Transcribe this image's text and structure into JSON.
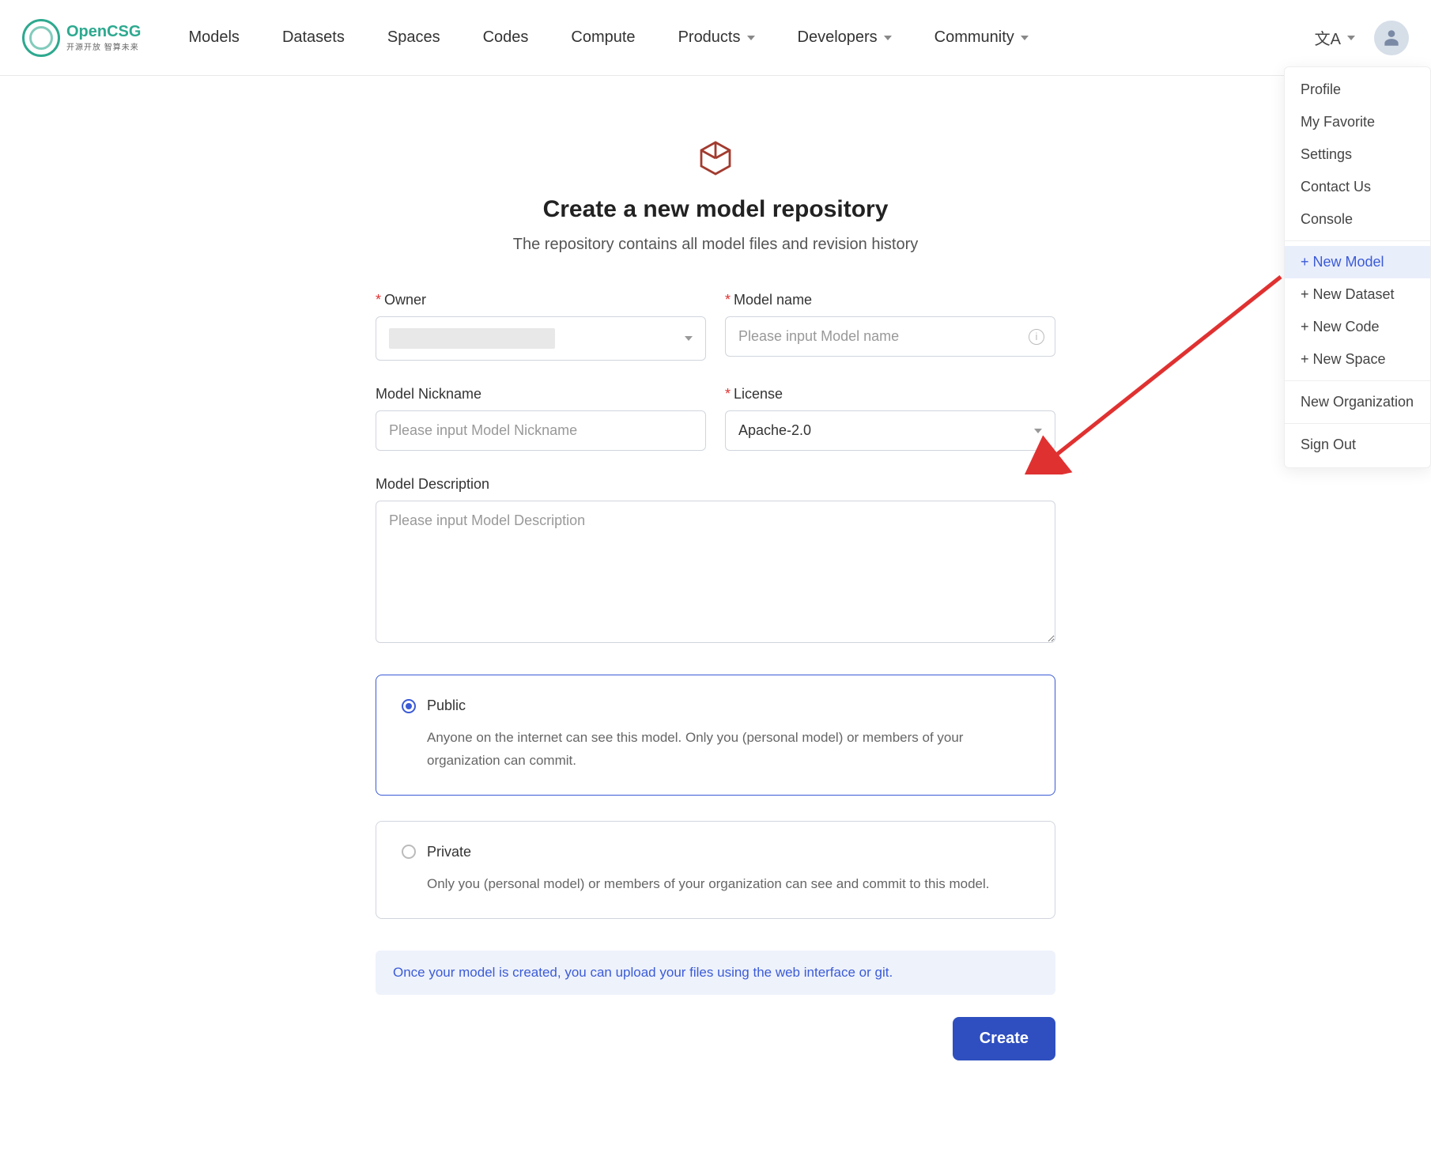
{
  "header": {
    "brand_name": "OpenCSG",
    "brand_sub": "开源开放 智算未来",
    "nav": [
      "Models",
      "Datasets",
      "Spaces",
      "Codes",
      "Compute",
      "Products",
      "Developers",
      "Community"
    ],
    "nav_has_chev": [
      false,
      false,
      false,
      false,
      false,
      true,
      true,
      true
    ],
    "lang_glyph": "文A"
  },
  "dropdown": {
    "group1": [
      "Profile",
      "My Favorite",
      "Settings",
      "Contact Us",
      "Console"
    ],
    "group2": [
      "+ New Model",
      "+ New Dataset",
      "+ New Code",
      "+ New Space"
    ],
    "group2_active_index": 0,
    "group3": [
      "New Organization"
    ],
    "group4": [
      "Sign Out"
    ]
  },
  "page": {
    "title": "Create a new model repository",
    "subtitle": "The repository contains all model files and revision history"
  },
  "form": {
    "owner_label": "Owner",
    "model_name_label": "Model name",
    "model_name_placeholder": "Please input Model name",
    "nickname_label": "Model Nickname",
    "nickname_placeholder": "Please input Model Nickname",
    "license_label": "License",
    "license_value": "Apache-2.0",
    "description_label": "Model Description",
    "description_placeholder": "Please input Model Description",
    "public_title": "Public",
    "public_desc": "Anyone on the internet can see this model. Only you (personal model) or members of your organization can commit.",
    "private_title": "Private",
    "private_desc": "Only you (personal model) or members of your organization can see and commit to this model.",
    "notice": "Once your model is created, you can upload your files using the web interface or git.",
    "create_label": "Create"
  }
}
